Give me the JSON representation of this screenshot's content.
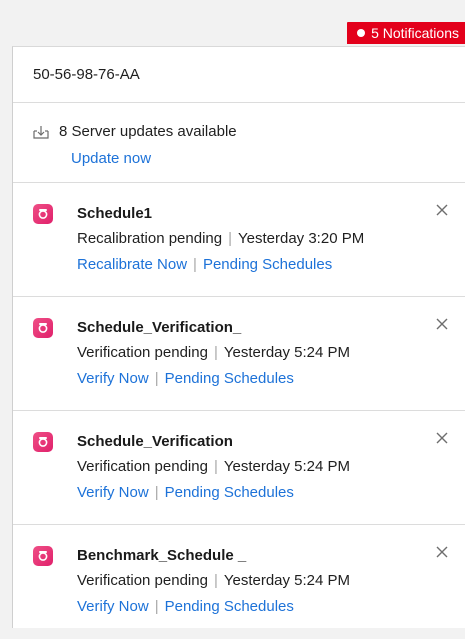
{
  "header": {
    "notifications_label": "5 Notifications",
    "accent_color": "#e3001b"
  },
  "device": {
    "id": "50-56-98-76-AA"
  },
  "server_updates": {
    "icon": "download-tray-icon",
    "message": "8 Server updates available",
    "action_label": "Update now"
  },
  "notifications": [
    {
      "icon": "app-badge-icon",
      "title": "Schedule1",
      "status": "Recalibration pending",
      "time": "Yesterday 3:20 PM",
      "primary_action": "Recalibrate Now",
      "secondary_action": "Pending Schedules"
    },
    {
      "icon": "app-badge-icon",
      "title": "Schedule_Verification_",
      "status": "Verification pending",
      "time": "Yesterday 5:24 PM",
      "primary_action": "Verify Now",
      "secondary_action": "Pending Schedules"
    },
    {
      "icon": "app-badge-icon",
      "title": "Schedule_Verification",
      "status": "Verification pending",
      "time": "Yesterday 5:24 PM",
      "primary_action": "Verify Now",
      "secondary_action": "Pending Schedules"
    },
    {
      "icon": "app-badge-icon",
      "title": "Benchmark_Schedule _",
      "status": "Verification pending",
      "time": "Yesterday 5:24 PM",
      "primary_action": "Verify Now",
      "secondary_action": "Pending Schedules"
    }
  ],
  "separator": "|",
  "colors": {
    "link": "#1d72d8",
    "icon_pink": "#e8306f"
  }
}
